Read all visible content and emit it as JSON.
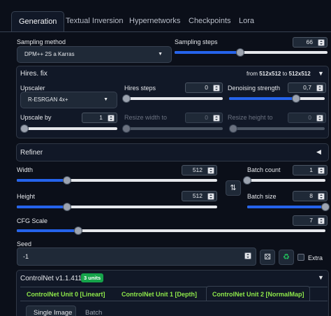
{
  "tabs": [
    {
      "label": "Generation",
      "active": true
    },
    {
      "label": "Textual Inversion",
      "active": false
    },
    {
      "label": "Hypernetworks",
      "active": false
    },
    {
      "label": "Checkpoints",
      "active": false
    },
    {
      "label": "Lora",
      "active": false
    }
  ],
  "sampling": {
    "method_label": "Sampling method",
    "method_value": "DPM++ 2S a Karras",
    "steps_label": "Sampling steps",
    "steps_value": "66",
    "steps_fraction": 0.43
  },
  "hires": {
    "title": "Hires. fix",
    "from_prefix": "from",
    "from_size": "512x512",
    "to_prefix": "to",
    "to_size": "512x512",
    "upscaler_label": "Upscaler",
    "upscaler_value": "R-ESRGAN 4x+",
    "hires_steps_label": "Hires steps",
    "hires_steps_value": "0",
    "hires_steps_fraction": 0.0,
    "denoise_label": "Denoising strength",
    "denoise_value": "0,7",
    "denoise_fraction": 0.7,
    "upscale_by_label": "Upscale by",
    "upscale_by_value": "1",
    "upscale_by_fraction": 0.0,
    "resize_w_label": "Resize width to",
    "resize_w_value": "0",
    "resize_h_label": "Resize height to",
    "resize_h_value": "0"
  },
  "refiner": {
    "title": "Refiner"
  },
  "dims": {
    "width_label": "Width",
    "width_value": "512",
    "width_fraction": 0.25,
    "height_label": "Height",
    "height_value": "512",
    "height_fraction": 0.25,
    "batch_count_label": "Batch count",
    "batch_count_value": "1",
    "batch_count_fraction": 0.0,
    "batch_size_label": "Batch size",
    "batch_size_value": "8",
    "batch_size_fraction": 1.0,
    "cfg_label": "CFG Scale",
    "cfg_value": "7",
    "cfg_fraction": 0.2,
    "swap_icon": "swap-icon"
  },
  "seed": {
    "label": "Seed",
    "value": "-1",
    "dice_icon": "dice-icon",
    "recycle_icon": "recycle-icon",
    "extra_label": "Extra"
  },
  "controlnet": {
    "title": "ControlNet v1.1.411",
    "badge": "3 units",
    "unit_tabs": [
      "ControlNet Unit 0 [Lineart]",
      "ControlNet Unit 1 [Depth]",
      "ControlNet Unit 2 [NormalMap]"
    ],
    "sub_tabs": [
      "Single Image",
      "Batch"
    ]
  },
  "colors": {
    "accent": "#2563eb",
    "background": "#0b0f19",
    "panel": "#111827",
    "green": "#8ee84a",
    "badge_green": "#16a34a"
  }
}
